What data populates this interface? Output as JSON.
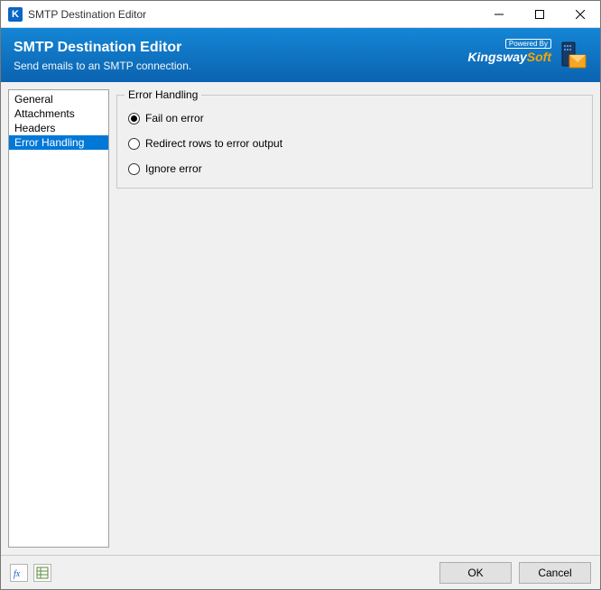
{
  "window": {
    "title": "SMTP Destination Editor"
  },
  "banner": {
    "title": "SMTP Destination Editor",
    "subtitle": "Send emails to an SMTP connection.",
    "powered_by": "Powered By",
    "brand_a": "Kingsway",
    "brand_b": "Soft"
  },
  "sidebar": {
    "items": [
      {
        "label": "General",
        "selected": false
      },
      {
        "label": "Attachments",
        "selected": false
      },
      {
        "label": "Headers",
        "selected": false
      },
      {
        "label": "Error Handling",
        "selected": true
      }
    ]
  },
  "main": {
    "group_title": "Error Handling",
    "options": [
      {
        "label": "Fail on error",
        "checked": true
      },
      {
        "label": "Redirect rows to error output",
        "checked": false
      },
      {
        "label": "Ignore error",
        "checked": false
      }
    ]
  },
  "footer": {
    "ok": "OK",
    "cancel": "Cancel"
  }
}
